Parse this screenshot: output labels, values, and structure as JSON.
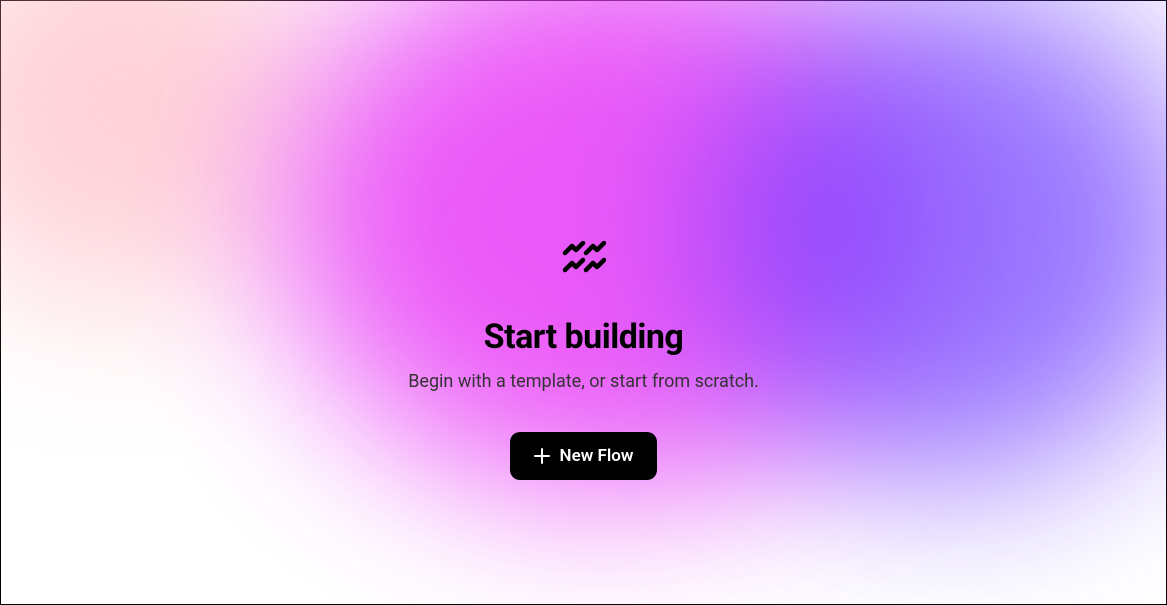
{
  "hero": {
    "title": "Start building",
    "subtitle": "Begin with a template, or start from scratch."
  },
  "actions": {
    "new_flow_label": "New Flow"
  }
}
